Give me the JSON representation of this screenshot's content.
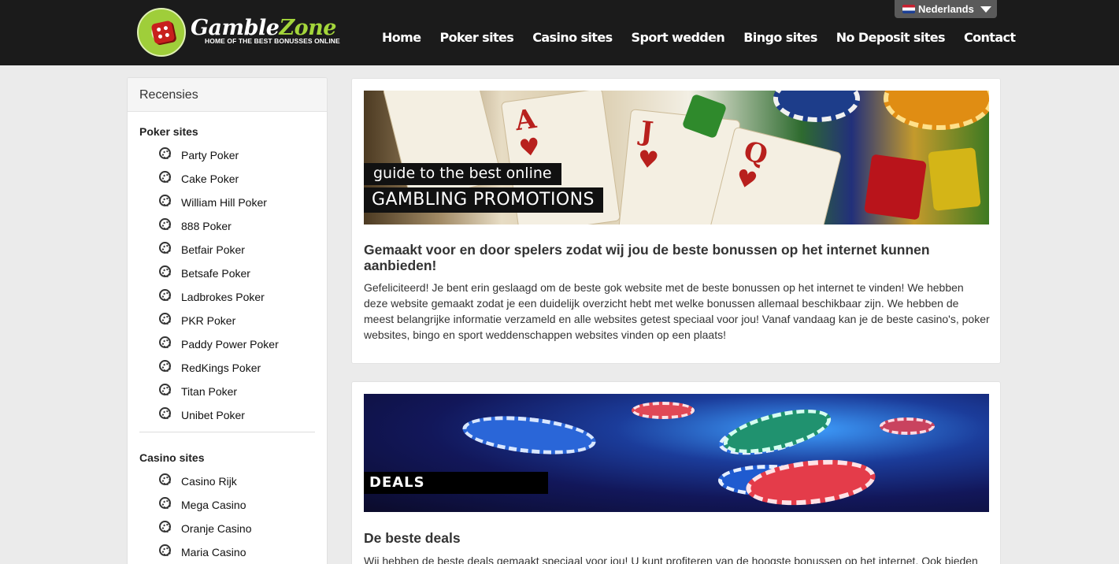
{
  "header": {
    "logo_name_part1": "Gamble",
    "logo_name_part2": "Zone",
    "logo_tagline": "HOME OF THE BEST BONUSSES ONLINE",
    "nav": [
      "Home",
      "Poker sites",
      "Casino sites",
      "Sport wedden",
      "Bingo sites",
      "No Deposit sites",
      "Contact"
    ],
    "language": "Nederlands"
  },
  "sidebar": {
    "title": "Recensies",
    "poker_title": "Poker sites",
    "poker_items": [
      "Party Poker",
      "Cake Poker",
      "William Hill Poker",
      "888 Poker",
      "Betfair Poker",
      "Betsafe Poker",
      "Ladbrokes Poker",
      "PKR Poker",
      "Paddy Power Poker",
      "RedKings Poker",
      "Titan Poker",
      "Unibet Poker"
    ],
    "casino_title": "Casino sites",
    "casino_items": [
      "Casino Rijk",
      "Mega Casino",
      "Oranje Casino",
      "Maria Casino"
    ]
  },
  "cards": [
    {
      "banner_sub": "guide to the best online",
      "banner_main": "GAMBLING PROMOTIONS",
      "title": "Gemaakt voor en door spelers zodat wij jou de beste bonussen op het internet kunnen aanbieden!",
      "text": "Gefeliciteerd! Je bent erin geslaagd om de beste gok website met de beste bonussen op het internet te vinden! We hebben deze website gemaakt zodat je een duidelijk overzicht hebt met welke bonussen allemaal beschikbaar zijn. We hebben de meest belangrijke informatie verzameld en alle websites getest speciaal voor jou! Vanaf vandaag kan je de beste casino's, poker websites, bingo en sport weddenschappen websites vinden op een plaats!"
    },
    {
      "banner_main": "DEALS",
      "title": "De beste deals",
      "text": "Wij hebben de beste deals gemaakt speciaal voor jou! U kunt profiteren van de hoogste bonussen op het internet. Ook bieden"
    }
  ],
  "colors": {
    "header_bg": "#1b1b1b",
    "page_bg": "#ebebeb",
    "logo_accent": "#a4d63b",
    "lang_bg": "#5a5a5a"
  },
  "icons": {
    "sidebar_bullet": "poker-chip-icon",
    "language_flag": "netherlands-flag-icon",
    "language_dropdown": "caret-down-icon"
  }
}
